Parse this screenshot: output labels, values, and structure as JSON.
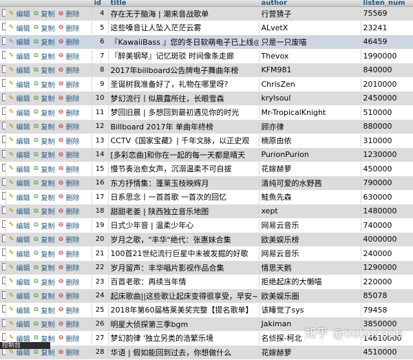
{
  "columns": [
    "",
    "id",
    "title",
    "author",
    "listen_num"
  ],
  "actions": {
    "edit": "编辑",
    "copy": "复制",
    "delete": "删除"
  },
  "rows": [
    {
      "id": "4",
      "title": "存在无于脑海 | 潮来音战歌单",
      "author": "行营猜子",
      "listen": "75569"
    },
    {
      "id": "5",
      "title": "这些嗓音让人坠入茫茫云雾",
      "author": "ALvetX",
      "listen": "23241"
    },
    {
      "id": "6",
      "title": "『KawaiiBass 』您的冬日软萌电子已上线◎",
      "author": "只是一只废喵",
      "listen": "46459"
    },
    {
      "id": "7",
      "title": "『醉美钢琴』记忆斑驳 时间像条走廊",
      "author": "Thevox",
      "listen": "1990000"
    },
    {
      "id": "8",
      "title": "2017年billboard公告牌电子舞曲年榜",
      "author": "KFM981",
      "listen": "840000"
    },
    {
      "id": "9",
      "title": "圣诞树我准备好了，礼物在哪里呀?",
      "author": "ChrisZen",
      "listen": "2010000"
    },
    {
      "id": "10",
      "title": "梦幻流行丨似晨露所往，长眼雪森",
      "author": "krylsoul",
      "listen": "2450000"
    },
    {
      "id": "11",
      "title": "梦回旧晨 | 多想回到最初遇见你的时光",
      "author": "Mr-TropicalKnight",
      "listen": "510000"
    },
    {
      "id": "12",
      "title": "Billboard 2017年 单曲年终榜",
      "author": "顾亦律",
      "listen": "880000"
    },
    {
      "id": "13",
      "title": "CCTV《国家宝藏》| 千年文脉，以正史观",
      "author": "楠原由依",
      "listen": "310000"
    },
    {
      "id": "14",
      "title": "[多彩恋曲]和你在一起的每一天都是晴天",
      "author": "PurionPurion",
      "listen": "1230000"
    },
    {
      "id": "15",
      "title": "慢节奏治愈女声，沉溺温柔不可自拔",
      "author": "花嫁赫萝",
      "listen": "450000"
    },
    {
      "id": "16",
      "title": "东方抒情集：蓬莱玉枝映辉月",
      "author": "清纯可爱的水野茜",
      "listen": "790000"
    },
    {
      "id": "17",
      "title": "日系思念丨一首首歌 一首次的回忆",
      "author": "鮭魚先森",
      "listen": "630000"
    },
    {
      "id": "18",
      "title": "甜甜老姜 | 陕西独立音乐地图",
      "author": "xept",
      "listen": "1480000"
    },
    {
      "id": "19",
      "title": "日式少年音 | 温柔少年心",
      "author": "网易云音乐",
      "listen": "740000"
    },
    {
      "id": "20",
      "title": "岁月之歌，\"丰华\"绝代：张惠妹合集",
      "author": "欧美娱乐榜",
      "listen": "4000000"
    },
    {
      "id": "21",
      "title": "100首21世纪流行巨星中未被发掘的好歌",
      "author": "网易云音乐",
      "listen": "240000"
    },
    {
      "id": "22",
      "title": "岁月留声：丰华唱片影视作品合集",
      "author": "情思天鹅",
      "listen": "1290000"
    },
    {
      "id": "23",
      "title": "百首老歌：再续当年情",
      "author": "拒绝起床的大懒喵",
      "listen": "220000"
    },
    {
      "id": "24",
      "title": "起床歌曲||这些歌让起床变得很享受，早安~",
      "author": "欧美娱乐圈",
      "listen": "85078"
    },
    {
      "id": "25",
      "title": "2018年第60届格莱美奖完整【提名歌单】",
      "author": "该睡觉了sys",
      "listen": "79458"
    },
    {
      "id": "26",
      "title": "明星大侦探第三季bgm",
      "author": "Jakiman",
      "listen": "3850000"
    },
    {
      "id": "27",
      "title": "梦幻韵律 '独立另类的浩繁乐境",
      "author": "名侦探-柯北",
      "listen": "14610000"
    },
    {
      "id": "28",
      "title": "华语 | 假如能回到过去，你想做什么",
      "author": "花嫁赫萝",
      "listen": "4510000"
    }
  ],
  "watermark": "知乎 @bobocode",
  "footer": "控制台"
}
